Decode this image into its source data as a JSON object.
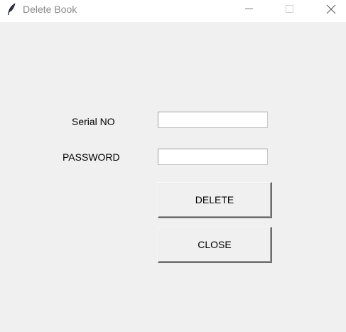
{
  "window": {
    "title": "Delete Book",
    "app_icon": "feather-icon",
    "controls": {
      "minimize_icon": "minimize-icon",
      "maximize_icon": "maximize-icon",
      "close_icon": "close-icon"
    }
  },
  "form": {
    "serial_label": "Serial NO",
    "serial_value": "",
    "password_label": "PASSWORD",
    "password_value": ""
  },
  "buttons": {
    "delete_label": "DELETE",
    "close_label": "CLOSE"
  },
  "colors": {
    "background": "#f0f0f0",
    "titlebar": "#ffffff",
    "title_text": "#8a8a8a"
  }
}
